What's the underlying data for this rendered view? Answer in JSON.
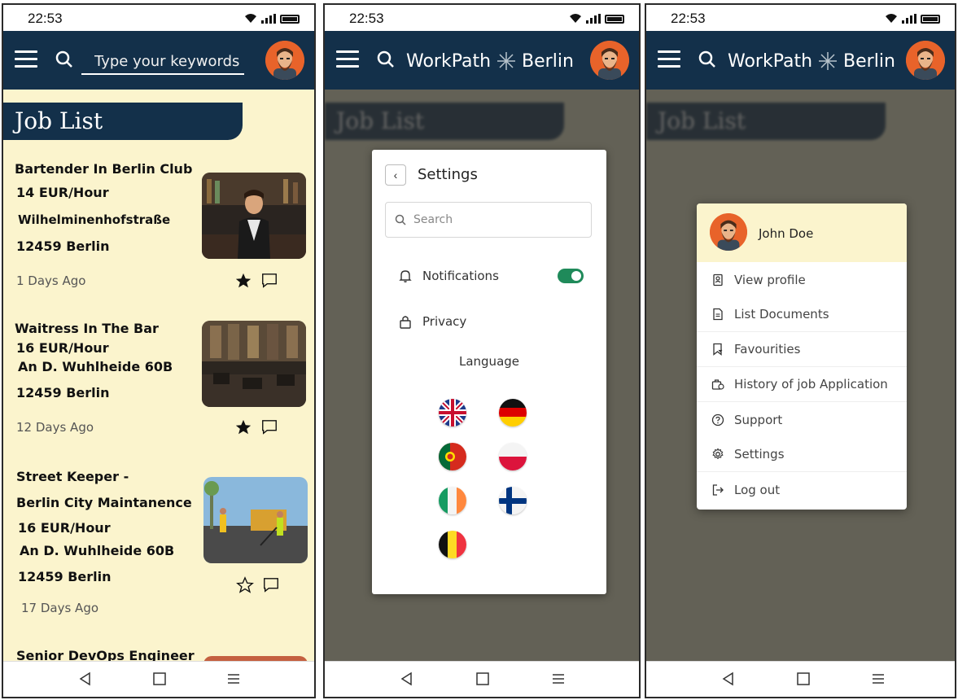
{
  "status": {
    "time": "22:53"
  },
  "screen1": {
    "search_placeholder": "Type your keywords",
    "title": "Job List",
    "jobs": [
      {
        "lines": [
          "Bartender In Berlin Club",
          "14 EUR/Hour",
          "Wilhelminenhofstraße",
          "12459 Berlin"
        ],
        "ago": "1 Days Ago",
        "favorite": true
      },
      {
        "lines": [
          "Waitress In The Bar",
          "16 EUR/Hour",
          "An D. Wuhlheide 60B",
          "12459 Berlin"
        ],
        "ago": "12 Days Ago",
        "favorite": true
      },
      {
        "lines": [
          "Street Keeper -",
          "Berlin City Maintanence",
          "16 EUR/Hour",
          "An D. Wuhlheide 60B",
          "12459 Berlin"
        ],
        "ago": "17 Days Ago",
        "favorite": false
      },
      {
        "lines": [
          "Senior DevOps Engineer"
        ],
        "ago": "",
        "favorite": false
      }
    ]
  },
  "brand": {
    "name": "WorkPath",
    "city": "Berlin"
  },
  "settings": {
    "title": "Settings",
    "search_placeholder": "Search",
    "notifications_label": "Notifications",
    "notifications_on": true,
    "privacy_label": "Privacy",
    "language_label": "Language",
    "flags": [
      "uk-flag",
      "germany-flag",
      "portugal-flag",
      "poland-flag",
      "ireland-flag",
      "finland-flag",
      "belgium-flag"
    ]
  },
  "profile_menu": {
    "user_name": "John Doe",
    "items": [
      "View profile",
      "List Documents",
      "Favourities",
      "History of job Application",
      "Support",
      "Settings",
      "Log out"
    ]
  },
  "colors": {
    "appbar": "#13304a",
    "background": "#fbf4cd",
    "toggle": "#1f8a5a",
    "avatar": "#e8632a"
  }
}
